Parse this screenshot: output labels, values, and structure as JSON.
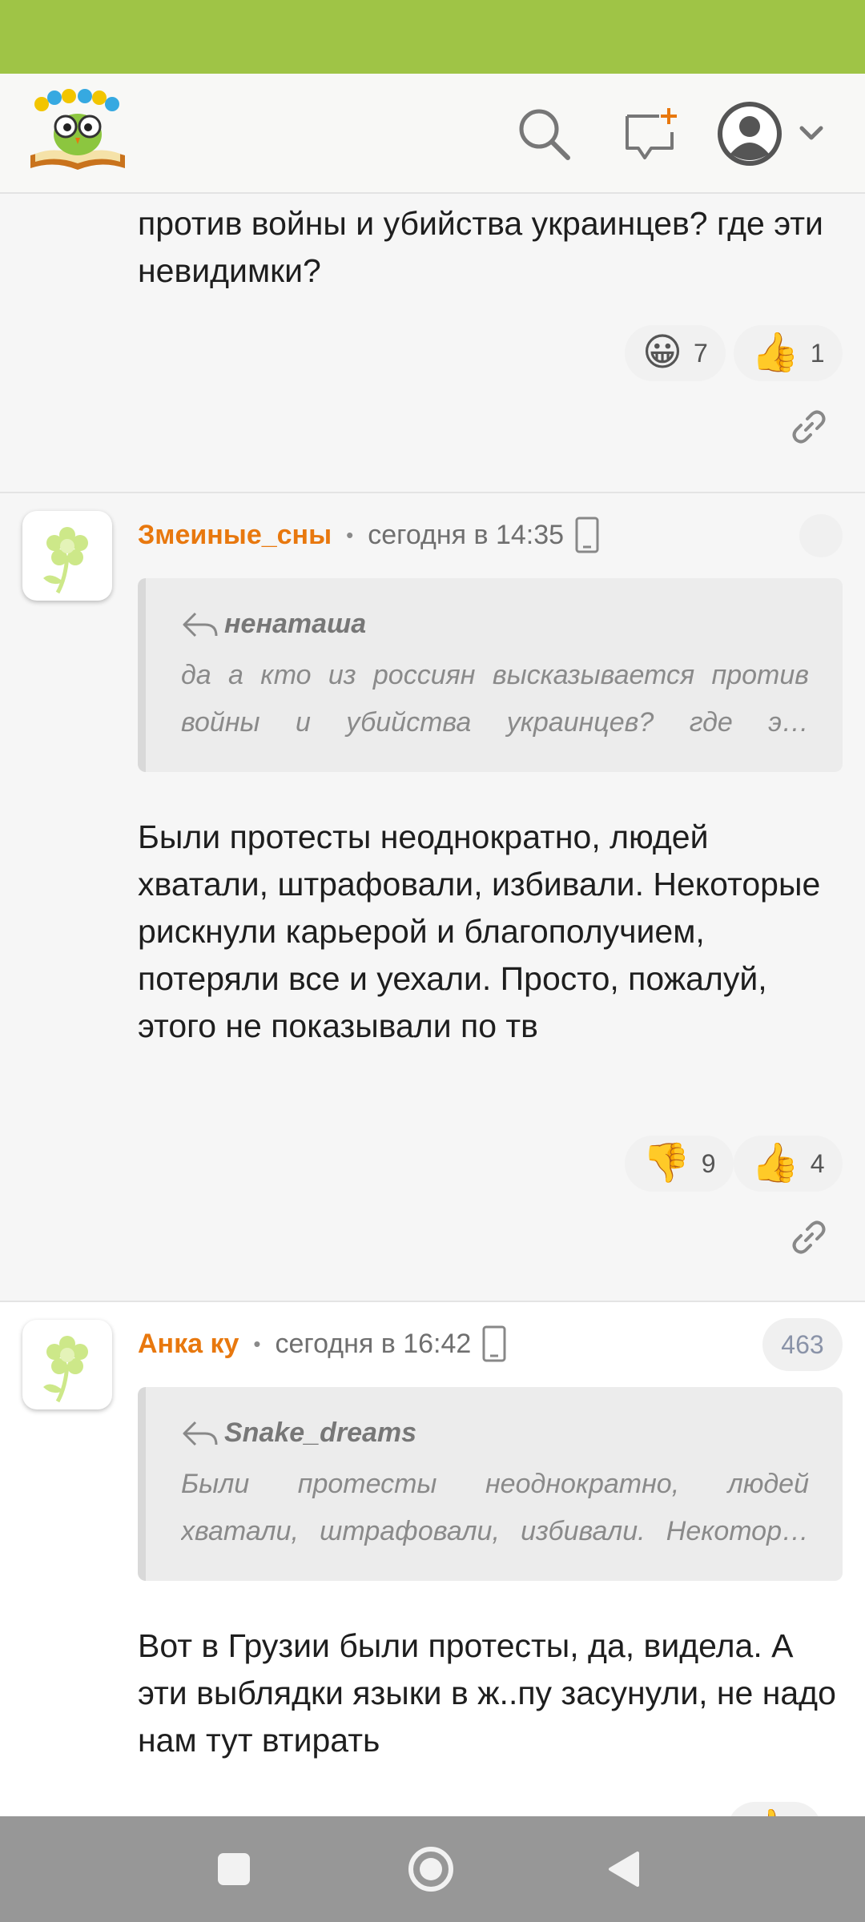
{
  "header": {
    "logo_icon": "owl-on-book-logo",
    "search_icon": "search-icon",
    "new_message_icon": "new-message-icon",
    "profile_icon": "profile-avatar-icon"
  },
  "comments": [
    {
      "text": "против войны и убийства украинцев? где эти невидимки?",
      "reactions": [
        {
          "emoji": "😀",
          "count": "7"
        },
        {
          "emoji": "👍",
          "count": "1"
        }
      ]
    },
    {
      "author": "Змеиные_сны",
      "separator": "•",
      "time": "сегодня в 14:35",
      "quote_author": "ненаташа",
      "quote_text": "да а кто из россиян высказывается против войны и убийства украинцев? где э…",
      "text": "Были протесты неоднократно, людей хватали, штрафовали, избивали. Некоторые рискнули карьерой и благополучием, потеряли все и уехали. Просто, пожалуй, этого не показывали по тв",
      "reactions": [
        {
          "emoji": "👎",
          "count": "9"
        },
        {
          "emoji": "👍",
          "count": "4"
        }
      ]
    },
    {
      "author": "Анка ку",
      "separator": "•",
      "time": "сегодня в 16:42",
      "badge": "463",
      "quote_author": "Snake_dreams",
      "quote_text": "Были протесты неоднократно, людей хватали, штрафовали, избивали. Некотор…",
      "text": "Вот в Грузии были протесты, да, видела. А эти выблядки языки в ж..пу засунули, не надо нам тут втирать",
      "reactions": [
        {
          "emoji": "👍",
          "count": ""
        }
      ]
    }
  ],
  "colors": {
    "status_bar": "#9fc446",
    "author": "#e8780e",
    "nav_bar": "#979797"
  }
}
